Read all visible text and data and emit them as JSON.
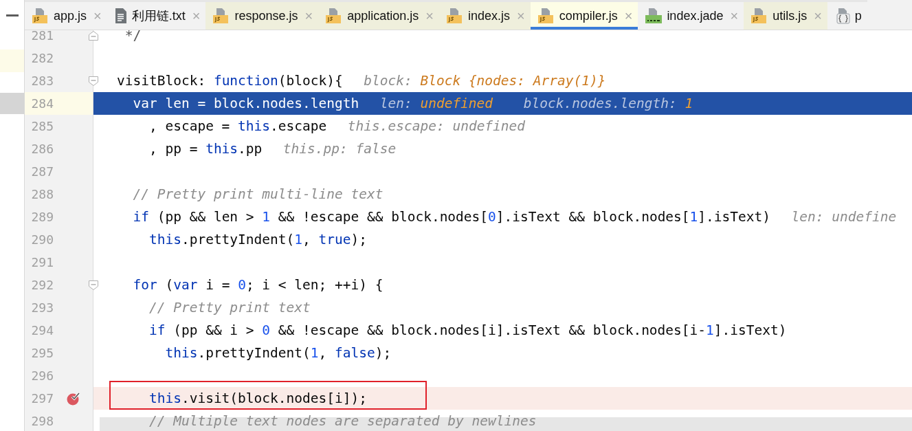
{
  "tabs": [
    {
      "label": "app.js",
      "kind": "js",
      "selected": false,
      "close": "×",
      "color": "#f2f2f2"
    },
    {
      "label": "利用链.txt",
      "kind": "text",
      "selected": false,
      "close": "×",
      "color": "#f2f2f2"
    },
    {
      "label": "response.js",
      "kind": "js",
      "selected": false,
      "close": "×",
      "color": "#efefdc"
    },
    {
      "label": "application.js",
      "kind": "js",
      "selected": false,
      "close": "×",
      "color": "#efefdc"
    },
    {
      "label": "index.js",
      "kind": "js",
      "selected": false,
      "close": "×",
      "color": "#efefdc"
    },
    {
      "label": "compiler.js",
      "kind": "js",
      "selected": true,
      "close": "×",
      "color": "#fdfde6"
    },
    {
      "label": "index.jade",
      "kind": "jade",
      "selected": false,
      "close": "×",
      "color": "#f2f2f2"
    },
    {
      "label": "utils.js",
      "kind": "js",
      "selected": false,
      "close": "×",
      "color": "#efefdc"
    },
    {
      "label": "p",
      "kind": "json",
      "selected": false,
      "color": "#f2f2f2"
    }
  ],
  "lines": [
    {
      "number": "281",
      "kind": "fold_end",
      "current": false,
      "breakpoint": false,
      "boxed": false,
      "code": [
        {
          "kind": "doc",
          "text": " */"
        }
      ]
    },
    {
      "number": "282",
      "kind": "plain",
      "current": false,
      "breakpoint": false,
      "boxed": false
    },
    {
      "number": "283",
      "kind": "fold_start",
      "current": false,
      "breakpoint": false,
      "boxed": false,
      "code": [
        {
          "kind": "plain",
          "text": "visitBlock: "
        },
        {
          "kind": "keyword",
          "text": "function"
        },
        {
          "kind": "plain",
          "text": "(block){"
        }
      ],
      "hints": [
        {
          "name": "block: ",
          "value": "Block {nodes: Array(1)}",
          "changed": true
        }
      ]
    },
    {
      "number": "284",
      "kind": "plain",
      "current": true,
      "breakpoint": false,
      "boxed": false,
      "code": [
        {
          "kind": "keyword",
          "text": "  var"
        },
        {
          "kind": "plain",
          "text": " len = block.nodes.length"
        }
      ],
      "hints": [
        {
          "name": "len: ",
          "value": "undefined",
          "changed": true
        },
        {
          "name": "block.nodes.length: ",
          "value": "1",
          "changed": true
        }
      ]
    },
    {
      "number": "285",
      "kind": "plain",
      "current": false,
      "breakpoint": false,
      "boxed": false,
      "code": [
        {
          "kind": "plain",
          "text": "    , escape = "
        },
        {
          "kind": "keyword",
          "text": "this"
        },
        {
          "kind": "plain",
          "text": ".escape"
        }
      ],
      "hints": [
        {
          "name": "this.escape: ",
          "value": "undefined",
          "changed": false
        }
      ]
    },
    {
      "number": "286",
      "kind": "plain",
      "current": false,
      "breakpoint": false,
      "boxed": false,
      "code": [
        {
          "kind": "plain",
          "text": "    , pp = "
        },
        {
          "kind": "keyword",
          "text": "this"
        },
        {
          "kind": "plain",
          "text": ".pp"
        }
      ],
      "hints": [
        {
          "name": "this.pp: ",
          "value": "false",
          "changed": false
        }
      ]
    },
    {
      "number": "287",
      "kind": "plain",
      "current": false,
      "breakpoint": false,
      "boxed": false
    },
    {
      "number": "288",
      "kind": "plain",
      "current": false,
      "breakpoint": false,
      "boxed": false,
      "code": [
        {
          "kind": "comment",
          "text": "  // Pretty print multi-line text"
        }
      ]
    },
    {
      "number": "289",
      "kind": "plain",
      "current": false,
      "breakpoint": false,
      "boxed": false,
      "code": [
        {
          "kind": "keyword",
          "text": "  if"
        },
        {
          "kind": "plain",
          "text": " (pp && len > "
        },
        {
          "kind": "number",
          "text": "1"
        },
        {
          "kind": "plain",
          "text": " && !escape && block.nodes["
        },
        {
          "kind": "number",
          "text": "0"
        },
        {
          "kind": "plain",
          "text": "].isText && block.nodes["
        },
        {
          "kind": "number",
          "text": "1"
        },
        {
          "kind": "plain",
          "text": "].isText)"
        }
      ],
      "hints": [
        {
          "name": "len: ",
          "value": "undefine",
          "changed": false
        }
      ]
    },
    {
      "number": "290",
      "kind": "plain",
      "current": false,
      "breakpoint": false,
      "boxed": false,
      "code": [
        {
          "kind": "keyword",
          "text": "    this"
        },
        {
          "kind": "plain",
          "text": ".prettyIndent("
        },
        {
          "kind": "number",
          "text": "1"
        },
        {
          "kind": "plain",
          "text": ", "
        },
        {
          "kind": "keyword",
          "text": "true"
        },
        {
          "kind": "plain",
          "text": ");"
        }
      ]
    },
    {
      "number": "291",
      "kind": "plain",
      "current": false,
      "breakpoint": false,
      "boxed": false
    },
    {
      "number": "292",
      "kind": "fold_start",
      "current": false,
      "breakpoint": false,
      "boxed": false,
      "code": [
        {
          "kind": "keyword",
          "text": "  for"
        },
        {
          "kind": "plain",
          "text": " ("
        },
        {
          "kind": "keyword",
          "text": "var"
        },
        {
          "kind": "plain",
          "text": " i = "
        },
        {
          "kind": "number",
          "text": "0"
        },
        {
          "kind": "plain",
          "text": "; i < len; ++i) {"
        }
      ]
    },
    {
      "number": "293",
      "kind": "plain",
      "current": false,
      "breakpoint": false,
      "boxed": false,
      "code": [
        {
          "kind": "comment",
          "text": "    // Pretty print text"
        }
      ]
    },
    {
      "number": "294",
      "kind": "plain",
      "current": false,
      "breakpoint": false,
      "boxed": false,
      "code": [
        {
          "kind": "keyword",
          "text": "    if"
        },
        {
          "kind": "plain",
          "text": " (pp && i > "
        },
        {
          "kind": "number",
          "text": "0"
        },
        {
          "kind": "plain",
          "text": " && !escape && block.nodes[i].isText && block.nodes[i-"
        },
        {
          "kind": "number",
          "text": "1"
        },
        {
          "kind": "plain",
          "text": "].isText)"
        }
      ]
    },
    {
      "number": "295",
      "kind": "plain",
      "current": false,
      "breakpoint": false,
      "boxed": false,
      "code": [
        {
          "kind": "keyword",
          "text": "      this"
        },
        {
          "kind": "plain",
          "text": ".prettyIndent("
        },
        {
          "kind": "number",
          "text": "1"
        },
        {
          "kind": "plain",
          "text": ", "
        },
        {
          "kind": "keyword",
          "text": "false"
        },
        {
          "kind": "plain",
          "text": ");"
        }
      ]
    },
    {
      "number": "296",
      "kind": "plain",
      "current": false,
      "breakpoint": false,
      "boxed": false
    },
    {
      "number": "297",
      "kind": "plain",
      "current": false,
      "breakpoint": true,
      "boxed": true,
      "code": [
        {
          "kind": "keyword",
          "text": "    this"
        },
        {
          "kind": "plain",
          "text": ".visit(block.nodes[i]);"
        }
      ]
    },
    {
      "number": "298",
      "kind": "plain",
      "current": false,
      "breakpoint": false,
      "boxed": false,
      "code": [
        {
          "kind": "comment",
          "text": "    // Multiple text nodes are separated by newlines"
        }
      ]
    }
  ]
}
